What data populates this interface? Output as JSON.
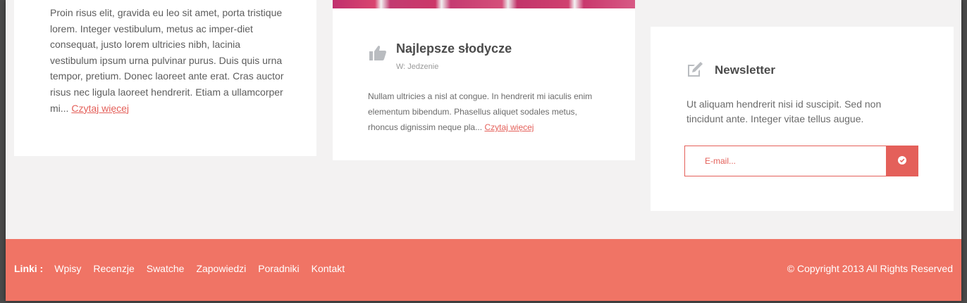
{
  "left_post": {
    "excerpt": "Proin risus elit, gravida eu leo sit amet, porta tristique lorem. Integer vestibulum, metus ac imper-diet consequat, justo lorem ultricies nibh, lacinia vestibulum ipsum urna pulvinar purus. Duis quis urna tempor, pretium. Donec laoreet ante erat. Cras auctor risus nec ligula laoreet hendrerit. Etiam a ullamcorper mi...",
    "read_more": "Czytaj więcej"
  },
  "mid_post": {
    "icon": "thumbs-up-icon",
    "title": "Najlepsze słodycze",
    "meta": "W: Jedzenie",
    "excerpt": "Nullam ultricies a nisl at congue. In hendrerit mi iaculis enim elementum bibendum. Phasellus aliquet sodales metus, rhoncus dignissim neque pla...",
    "read_more": "Czytaj więcej"
  },
  "newsletter": {
    "icon": "pencil-icon",
    "title": "Newsletter",
    "text": "Ut aliquam hendrerit nisi id suscipit. Sed non tincidunt ante. Integer vitae tellus augue.",
    "email_placeholder": "E-mail...",
    "submit_icon": "check-circle-icon"
  },
  "footer": {
    "links_label": "Linki :",
    "links": [
      "Wpisy",
      "Recenzje",
      "Swatche",
      "Zapowiedzi",
      "Poradniki",
      "Kontakt"
    ],
    "copyright": "© Copyright 2013  All Rights Reserved"
  },
  "colors": {
    "accent": "#e4605a",
    "footer_bg": "#f07465",
    "page_bg": "#f3f2f2",
    "card_bg": "#ffffff"
  }
}
